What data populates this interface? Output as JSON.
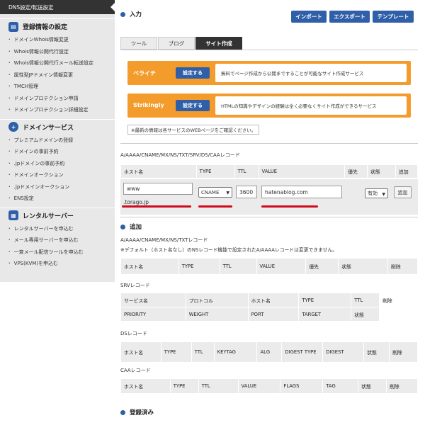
{
  "sidebar": {
    "active_item": "DNS設定/転送設定",
    "sections": [
      {
        "title": "登録情報の設定",
        "icon": "document-icon",
        "items": [
          "ドメインWhois情報変更",
          "Whois情報公開代行設定",
          "Whois情報公開代行メール転送設定",
          "属性型JPドメイン情報変更",
          "TMCH管理",
          "ドメインプロテクション申請",
          "ドメインプロテクション詳細設定"
        ]
      },
      {
        "title": "ドメインサービス",
        "icon": "plus-icon",
        "items": [
          "プレミアムドメインの登録",
          "ドメインの事前予約",
          ".jpドメインの事前予約",
          "ドメインオークション",
          ".jpドメインオークション",
          "ENS設定"
        ]
      },
      {
        "title": "レンタルサーバー",
        "icon": "server-icon",
        "items": [
          "レンタルサーバーを申込む",
          "メール専用サーバーを申込む",
          "一斉メール配信ツールを申込む",
          "VPS(KVM)を申込む"
        ]
      }
    ]
  },
  "input_section": {
    "title": "入力",
    "buttons": [
      "インポート",
      "エクスポート",
      "テンプレート"
    ]
  },
  "tabs": [
    "ツール",
    "ブログ",
    "サイト作成"
  ],
  "active_tab": "サイト作成",
  "services": [
    {
      "name": "ペライチ",
      "button": "設定する",
      "description": "無料でページ作成から公開まですることが可能なサイト作成サービス"
    },
    {
      "name": "Strikingly",
      "button": "設定する",
      "description": "HTMLの知識やデザインの経験は全く必要なくサイト作成ができるサービス"
    }
  ],
  "note": "※最新の情報は各サービスのWEBページをご確認ください。",
  "record_form": {
    "label": "A/AAAA/CNAME/MX/NS/TXT/SRV/DS/CAAレコード",
    "headers": [
      "ホスト名",
      "TYPE",
      "TTL",
      "VALUE",
      "優先",
      "状態",
      "追加"
    ],
    "host_value": "www",
    "domain_suffix": ".torago.jp",
    "type_value": "CNAME",
    "ttl_value": "3600",
    "value_value": "hatenablog.com",
    "status_value": "有効",
    "add_button": "追加"
  },
  "add_section": {
    "title": "追加",
    "a_label": "A/AAAA/CNAME/MX/NS/TXTレコード",
    "a_note": "※デフォルト（ホスト名なし）のNSレコード機能で設定されたA/AAAAレコードは変更できません。",
    "a_headers": [
      "ホスト名",
      "TYPE",
      "TTL",
      "VALUE",
      "優先",
      "状態",
      "削除"
    ],
    "srv_label": "SRVレコード",
    "srv_headers_1": [
      "サービス名",
      "プロトコル",
      "ホスト名",
      "TYPE",
      "TTL",
      "削除"
    ],
    "srv_headers_2": [
      "PRIORITY",
      "WEIGHT",
      "PORT",
      "TARGET",
      "状態"
    ],
    "ds_label": "DSレコード",
    "ds_headers": [
      "ホスト名",
      "TYPE",
      "TTL",
      "KEYTAG",
      "ALG",
      "DIGEST TYPE",
      "DIGEST",
      "状態",
      "削除"
    ],
    "caa_label": "CAAレコード",
    "caa_headers": [
      "ホスト名",
      "TYPE",
      "TTL",
      "VALUE",
      "FLAGS",
      "TAG",
      "状態",
      "削除"
    ]
  },
  "registered_section": {
    "title": "登録済み"
  },
  "colors": {
    "accent": "#2f5fa8",
    "orange": "#f39c2c",
    "annotation_red": "#d20a1e",
    "sidebar_bg": "#e8e8e8"
  }
}
